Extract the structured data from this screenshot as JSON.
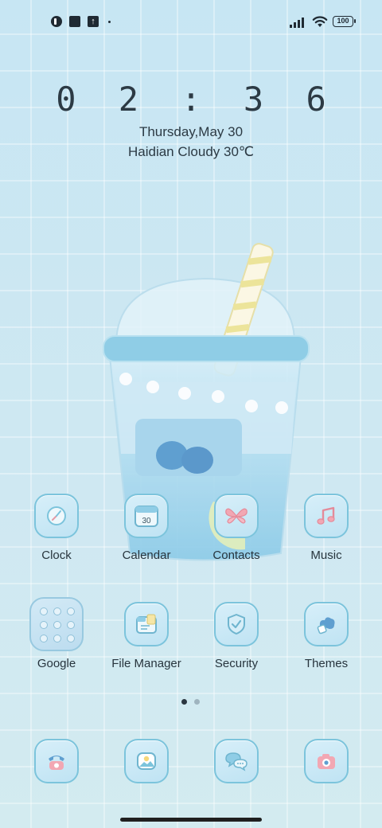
{
  "status_bar": {
    "battery": "100",
    "icons": [
      "notification-app-icon",
      "square-notification-icon",
      "upload-icon",
      "more-dot-icon",
      "signal-icon",
      "wifi-icon",
      "battery-icon"
    ]
  },
  "widget": {
    "time": "0 2 : 3 6",
    "date": "Thursday,May 30",
    "weather": "Haidian Cloudy 30℃"
  },
  "apps": [
    {
      "label": "Clock",
      "icon": "clock-icon"
    },
    {
      "label": "Calendar",
      "icon": "calendar-icon",
      "badge": "30"
    },
    {
      "label": "Contacts",
      "icon": "butterfly-icon"
    },
    {
      "label": "Music",
      "icon": "music-note-icon"
    },
    {
      "label": "Google",
      "icon": "folder-icon"
    },
    {
      "label": "File Manager",
      "icon": "folder-file-icon"
    },
    {
      "label": "Security",
      "icon": "shield-check-icon"
    },
    {
      "label": "Themes",
      "icon": "theme-brush-icon"
    }
  ],
  "dock": [
    {
      "icon": "phone-icon"
    },
    {
      "icon": "gallery-icon"
    },
    {
      "icon": "messages-icon"
    },
    {
      "icon": "camera-icon"
    }
  ],
  "pager": {
    "pages": 2,
    "current": 1
  },
  "colors": {
    "accent": "#7cc4dc",
    "pink": "#f2a7b3",
    "text": "#27343d"
  }
}
